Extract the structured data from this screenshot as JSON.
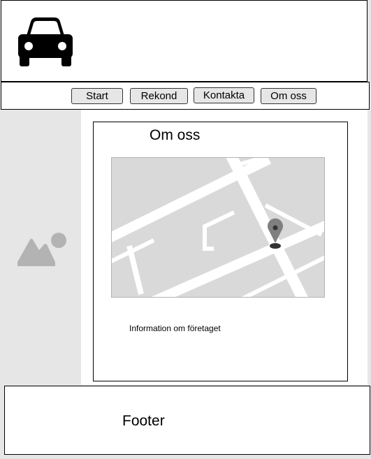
{
  "header": {
    "logo_icon": "car-icon"
  },
  "nav": {
    "items": [
      {
        "label": "Start"
      },
      {
        "label": "Rekond"
      },
      {
        "label": "Kontakta"
      },
      {
        "label": "Om oss"
      }
    ]
  },
  "sidebar": {
    "image_icon": "image-placeholder-icon"
  },
  "main": {
    "title": "Om oss",
    "map_icon": "map-icon",
    "map_pin_icon": "map-pin-icon",
    "info_text": "Information om företaget"
  },
  "footer": {
    "label": "Footer"
  },
  "colors": {
    "sidebar_bg": "#e6e6e6",
    "button_bg": "#e6e6e6",
    "map_bg": "#d9d9d9",
    "placeholder_gray": "#b3b3b3"
  }
}
